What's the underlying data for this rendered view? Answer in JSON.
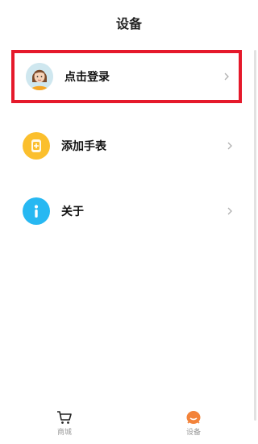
{
  "header": {
    "title": "设备"
  },
  "rows": [
    {
      "label": "点击登录",
      "icon": "user-avatar-icon"
    },
    {
      "label": "添加手表",
      "icon": "add-watch-icon"
    },
    {
      "label": "关于",
      "icon": "info-icon"
    }
  ],
  "tabbar": {
    "tabs": [
      {
        "label": "商城",
        "icon": "cart-icon",
        "active": false
      },
      {
        "label": "设备",
        "icon": "device-face-icon",
        "active": true
      }
    ]
  },
  "colors": {
    "highlight_border": "#e5192b",
    "watch_icon_bg": "#fbbf2d",
    "info_icon_bg": "#27b8f2",
    "active_tab_icon": "#f3833a"
  }
}
